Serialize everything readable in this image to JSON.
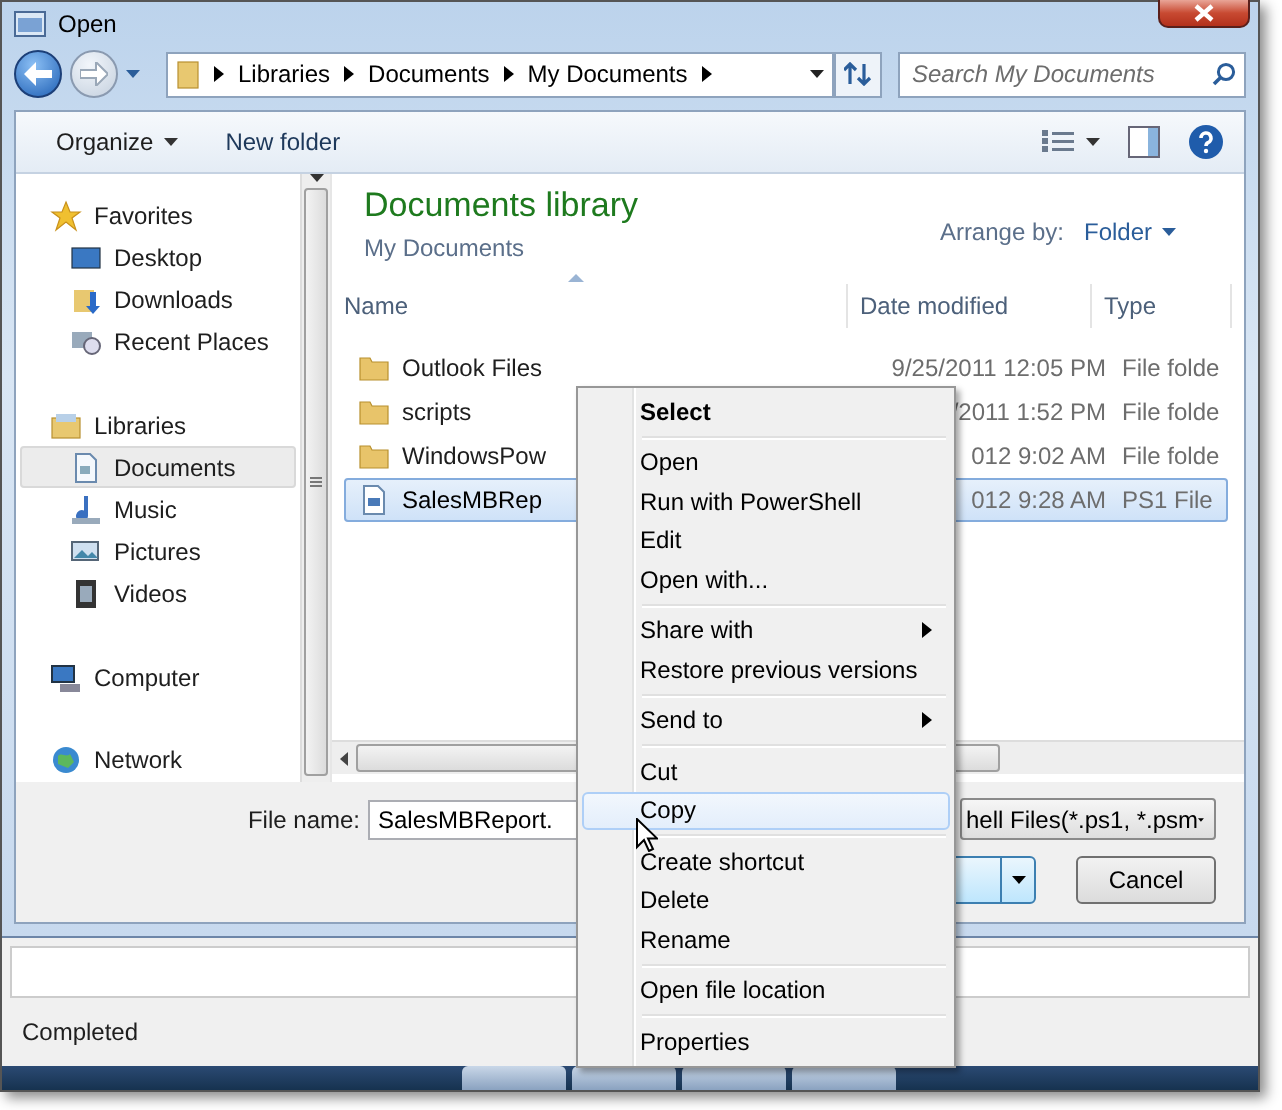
{
  "window": {
    "title": "Open"
  },
  "address": {
    "crumbs": [
      "Libraries",
      "Documents",
      "My Documents"
    ]
  },
  "search": {
    "placeholder": "Search My Documents"
  },
  "toolbar": {
    "buttons": [
      {
        "label": "Organize",
        "dropdown": true
      },
      {
        "label": "New folder",
        "dropdown": false
      }
    ]
  },
  "nav": {
    "groups": [
      {
        "label": "Favorites",
        "children": [
          {
            "label": "Desktop",
            "selected": false
          },
          {
            "label": "Downloads",
            "selected": false
          },
          {
            "label": "Recent Places",
            "selected": false
          }
        ]
      },
      {
        "label": "Libraries",
        "children": [
          {
            "label": "Documents",
            "selected": true
          },
          {
            "label": "Music",
            "selected": false
          },
          {
            "label": "Pictures",
            "selected": false
          },
          {
            "label": "Videos",
            "selected": false
          }
        ]
      },
      {
        "label": "Computer"
      },
      {
        "label": "Network"
      }
    ]
  },
  "library": {
    "title": "Documents library",
    "subtitle": "My Documents",
    "arrange_label": "Arrange by:",
    "arrange_value": "Folder"
  },
  "table": {
    "columns": [
      "Name",
      "Date modified",
      "Type"
    ],
    "rows": [
      {
        "name": "Outlook Files",
        "date": "9/25/2011 12:05 PM",
        "type": "File folde",
        "kind": "folder",
        "selected": false
      },
      {
        "name": "scripts",
        "date": "/2011 1:52 PM",
        "type": "File folde",
        "kind": "folder",
        "selected": false
      },
      {
        "name": "WindowsPow",
        "date": "012 9:02 AM",
        "type": "File folde",
        "kind": "folder",
        "selected": false
      },
      {
        "name": "SalesMBRep",
        "date": "012 9:28 AM",
        "type": "PS1 File",
        "kind": "script",
        "selected": true
      }
    ]
  },
  "file_name": {
    "label": "File name:",
    "value": "SalesMBReport.",
    "file_type": "hell Files(*.ps1, *.psm"
  },
  "buttons": [
    {
      "kind": "split"
    },
    {
      "label": "Cancel",
      "kind": "plain"
    }
  ],
  "context_menu": [
    {
      "label": "Select",
      "kind": "default",
      "selected": false
    },
    {
      "kind": "separator"
    },
    {
      "label": "Open",
      "kind": "item",
      "selected": false
    },
    {
      "label": "Run with PowerShell",
      "kind": "item",
      "selected": false
    },
    {
      "label": "Edit",
      "kind": "item",
      "selected": false
    },
    {
      "label": "Open with...",
      "kind": "item",
      "selected": false
    },
    {
      "kind": "separator"
    },
    {
      "label": "Share with",
      "kind": "submenu",
      "selected": false
    },
    {
      "label": "Restore previous versions",
      "kind": "item",
      "selected": false
    },
    {
      "kind": "separator"
    },
    {
      "label": "Send to",
      "kind": "submenu",
      "selected": false
    },
    {
      "kind": "separator"
    },
    {
      "label": "Cut",
      "kind": "item",
      "selected": false
    },
    {
      "label": "Copy",
      "kind": "item",
      "selected": true
    },
    {
      "kind": "separator"
    },
    {
      "label": "Create shortcut",
      "kind": "item",
      "selected": false
    },
    {
      "label": "Delete",
      "kind": "item",
      "selected": false
    },
    {
      "label": "Rename",
      "kind": "item",
      "selected": false
    },
    {
      "kind": "separator"
    },
    {
      "label": "Open file location",
      "kind": "item",
      "selected": false
    },
    {
      "kind": "separator"
    },
    {
      "label": "Properties",
      "kind": "item",
      "selected": false
    }
  ],
  "status_bar": {
    "text": "Completed"
  }
}
